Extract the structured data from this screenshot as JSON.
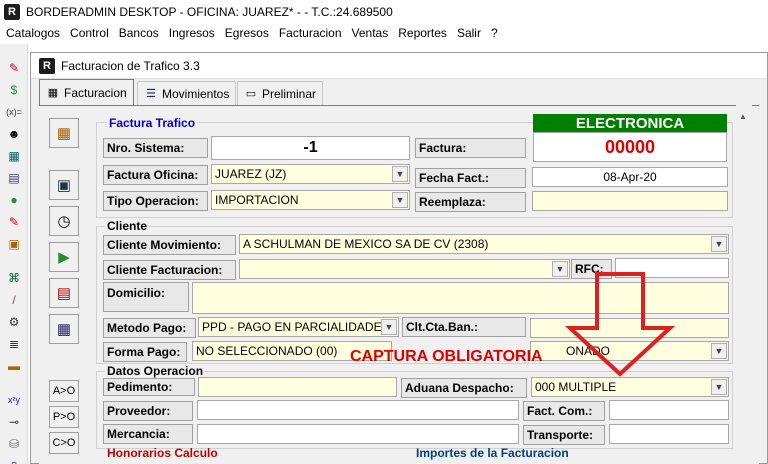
{
  "window": {
    "title": "BORDERADMIN DESKTOP - OFICINA: JUAREZ* -  - T.C.:24.689500",
    "app_icon": "R"
  },
  "menu": [
    "Catalogos",
    "Control",
    "Bancos",
    "Ingresos",
    "Egresos",
    "Facturacion",
    "Ventas",
    "Reportes",
    "Salir",
    "?"
  ],
  "child": {
    "title": "Facturacion de Trafico 3.3",
    "tabs": [
      "Facturacion",
      "Movimientos",
      "Preliminar"
    ]
  },
  "side_buttons": {
    "a_o": "A>O",
    "p_o": "P>O",
    "c_o": "C>O"
  },
  "form": {
    "section_factura": "Factura Trafico",
    "electronica": "ELECTRONICA",
    "folio": "00000",
    "nro_sistema_label": "Nro. Sistema:",
    "nro_sistema_value": "-1",
    "factura_label": "Factura:",
    "factura_oficina_label": "Factura Oficina:",
    "factura_oficina_value": "JUAREZ (JZ)",
    "fecha_fact_label": "Fecha Fact.:",
    "fecha_fact_value": "08-Apr-20",
    "tipo_operacion_label": "Tipo Operacion:",
    "tipo_operacion_value": "IMPORTACION",
    "reemplaza_label": "Reemplaza:",
    "section_cliente": "Cliente",
    "cliente_mov_label": "Cliente Movimiento:",
    "cliente_mov_value": "A SCHULMAN DE MEXICO SA DE CV (2308)",
    "cliente_fact_label": "Cliente Facturacion:",
    "cliente_fact_value": "",
    "rfc_label": "RFC:",
    "domicilio_label": "Domicilio:",
    "metodo_pago_label": "Metodo Pago:",
    "metodo_pago_value": "PPD - PAGO EN PARCIALIDADES",
    "clt_cta_ban_label": "Clt.Cta.Ban.:",
    "forma_pago_label": "Forma Pago:",
    "forma_pago_value": "NO SELECCIONADO (00)",
    "forma_pago_value2": "ONADO",
    "section_datos": "Datos Operacion",
    "pedimento_label": "Pedimento:",
    "aduana_label": "Aduana Despacho:",
    "aduana_value": "000 MULTIPLE",
    "proveedor_label": "Proveedor:",
    "fact_com_label": "Fact. Com.:",
    "mercancia_label": "Mercancia:",
    "transporte_label": "Transporte:",
    "section_honorarios": "Honorarios Calculo",
    "section_importes": "Importes de la Facturacion"
  },
  "annotation": {
    "text": "CAPTURA OBLIGATORIA",
    "color": "#e00000"
  },
  "colors": {
    "electronica_bg": "#008000",
    "folio_text": "#e00000",
    "section_blue": "#0000c0"
  }
}
